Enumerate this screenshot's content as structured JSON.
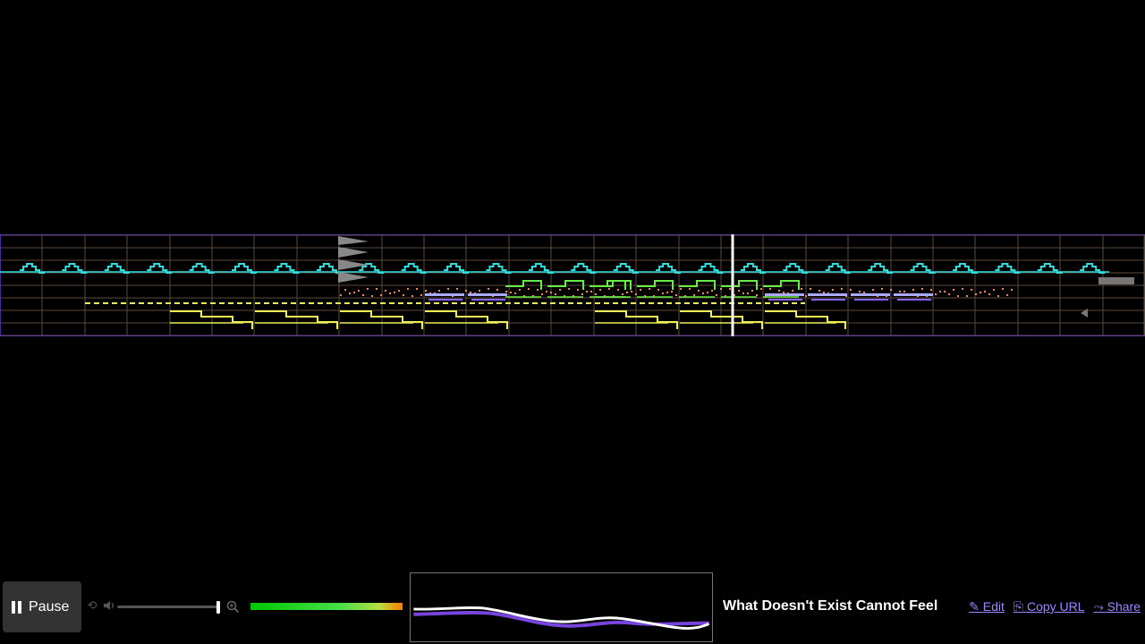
{
  "player": {
    "pause_label": "Pause",
    "volume_level": 0.98,
    "song_title": "What Doesn't Exist Cannot Feel"
  },
  "links": {
    "edit": "✎ Edit",
    "copy_url": "⎘ Copy URL",
    "share": "⤳ Share"
  },
  "icons": {
    "pause": "pause-icon",
    "loop": "loop-icon",
    "volume": "volume-icon",
    "zoom": "zoom-icon"
  },
  "colors": {
    "background": "#000000",
    "grid_line": "#5a4a3a",
    "channel_cyan": "#33dddd",
    "channel_yellow": "#eeee55",
    "channel_green": "#66ee44",
    "channel_orange": "#ee8855",
    "channel_purple": "#8866ff",
    "playhead": "#ffffff",
    "timeline_primary": "#ffffff",
    "timeline_secondary": "#7744dd"
  },
  "song": {
    "playhead_fraction": 0.64,
    "bar_count": 27
  }
}
